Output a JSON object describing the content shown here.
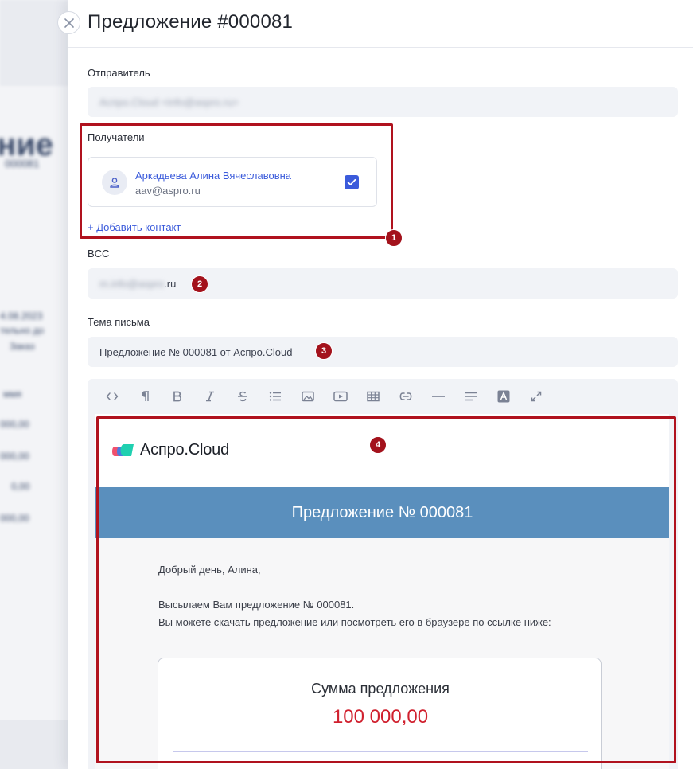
{
  "header": {
    "title": "Предложение #000081",
    "close_icon": "close-icon"
  },
  "form": {
    "sender_label": "Отправитель",
    "sender_value": "Аспро.Cloud <info@aspro.ru>",
    "recipients_label": "Получатели",
    "recipient": {
      "name": "Аркадьева Алина Вячеславовна",
      "email": "aav@aspro.ru",
      "checked": true
    },
    "add_contact": "+ Добавить контакт",
    "bcc_label": "BCC",
    "bcc_value_hidden": "m.info@aspro",
    "bcc_value_visible": ".ru",
    "subject_label": "Тема письма",
    "subject_value": "Предложение № 000081 от Аспро.Cloud"
  },
  "toolbar": {
    "buttons": [
      "code-icon",
      "paragraph-icon",
      "bold-icon",
      "italic-icon",
      "strikethrough-icon",
      "list-icon",
      "image-icon",
      "video-icon",
      "table-icon",
      "link-icon",
      "horizontal-rule-icon",
      "align-icon",
      "font-color-icon",
      "fullscreen-icon"
    ]
  },
  "email": {
    "logo_text": "Аспро.Cloud",
    "banner_title": "Предложение № 000081",
    "greeting": "Добрый день, Алина,",
    "line1": "Высылаем Вам предложение № 000081.",
    "line2": "Вы можете скачать предложение или посмотреть его в браузере по ссылке ниже:",
    "sum_title": "Сумма предложения",
    "sum_value": "100 000,00"
  },
  "annotations": [
    "1",
    "2",
    "3",
    "4"
  ],
  "background": {
    "heading_fragment": "ние",
    "subheading_fragment": "000081",
    "date_fragment": "4.08.2023",
    "lines": [
      "тельно до",
      "Заказ"
    ],
    "amounts": [
      "ммя",
      "000,00",
      "000,00",
      "0,00",
      "000,00"
    ]
  },
  "colors": {
    "accent": "#3b5bdb",
    "banner": "#5a8fbd",
    "sum": "#d0202e",
    "annotation": "#b0121e"
  }
}
